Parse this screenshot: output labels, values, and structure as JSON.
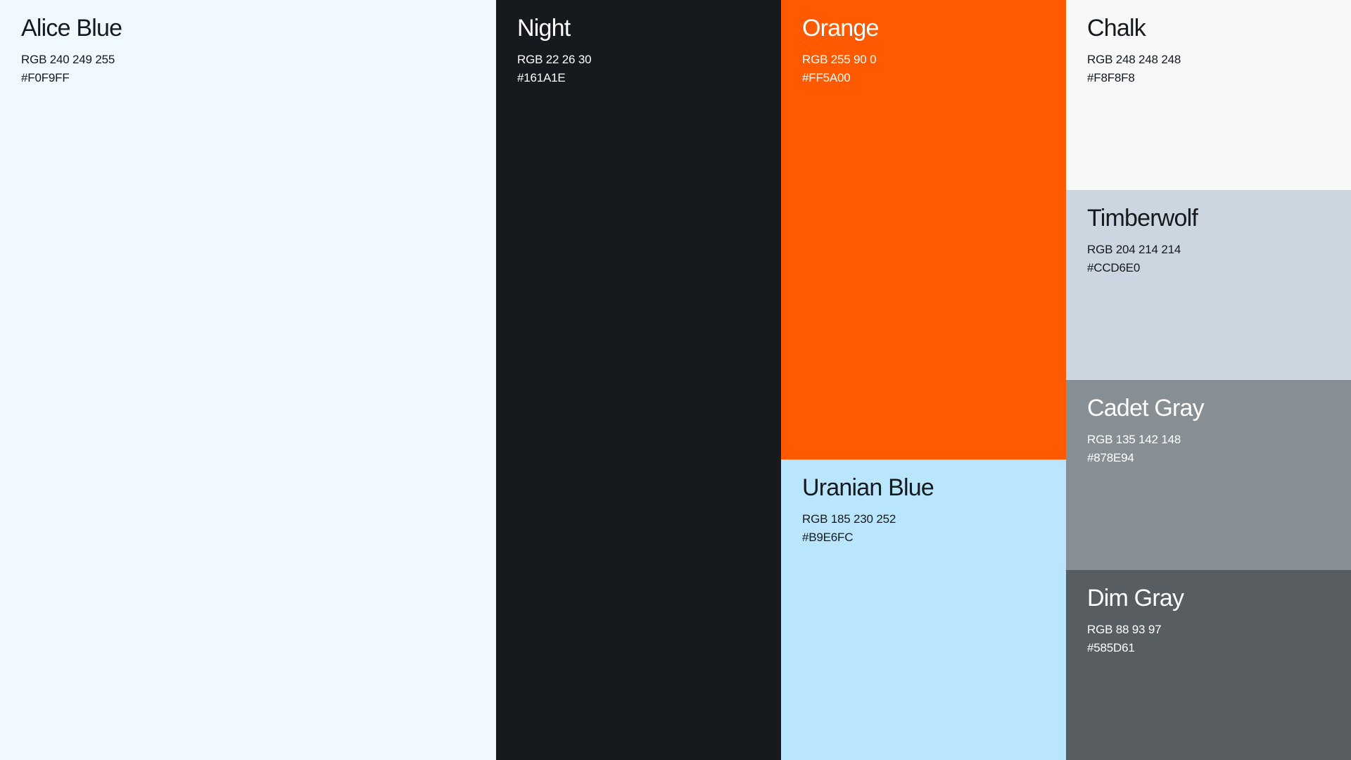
{
  "swatches": [
    {
      "name": "Alice Blue",
      "rgb": "RGB 240 249 255",
      "hex": "#F0F9FF",
      "bg": "#F0F9FF",
      "fg": "#16191E"
    },
    {
      "name": "Night",
      "rgb": "RGB 22 26 30",
      "hex": "#161A1E",
      "bg": "#161A1E",
      "fg": "#FFFFFF"
    },
    {
      "name": "Orange",
      "rgb": "RGB 255 90 0",
      "hex": "#FF5A00",
      "bg": "#FF5A00",
      "fg": "#FFFFFF"
    },
    {
      "name": "Uranian Blue",
      "rgb": "RGB 185 230 252",
      "hex": "#B9E6FC",
      "bg": "#B9E6FC",
      "fg": "#16191E"
    },
    {
      "name": "Chalk",
      "rgb": "RGB 248 248 248",
      "hex": "#F8F8F8",
      "bg": "#F8F8F8",
      "fg": "#16191E"
    },
    {
      "name": "Timberwolf",
      "rgb": "RGB 204 214 214",
      "hex": "#CCD6E0",
      "bg": "#CCD6E0",
      "fg": "#16191E"
    },
    {
      "name": "Cadet Gray",
      "rgb": "RGB 135 142 148",
      "hex": "#878E94",
      "bg": "#878E94",
      "fg": "#FFFFFF"
    },
    {
      "name": "Dim Gray",
      "rgb": "RGB 88 93 97",
      "hex": "#585D61",
      "bg": "#585D61",
      "fg": "#FFFFFF"
    }
  ]
}
